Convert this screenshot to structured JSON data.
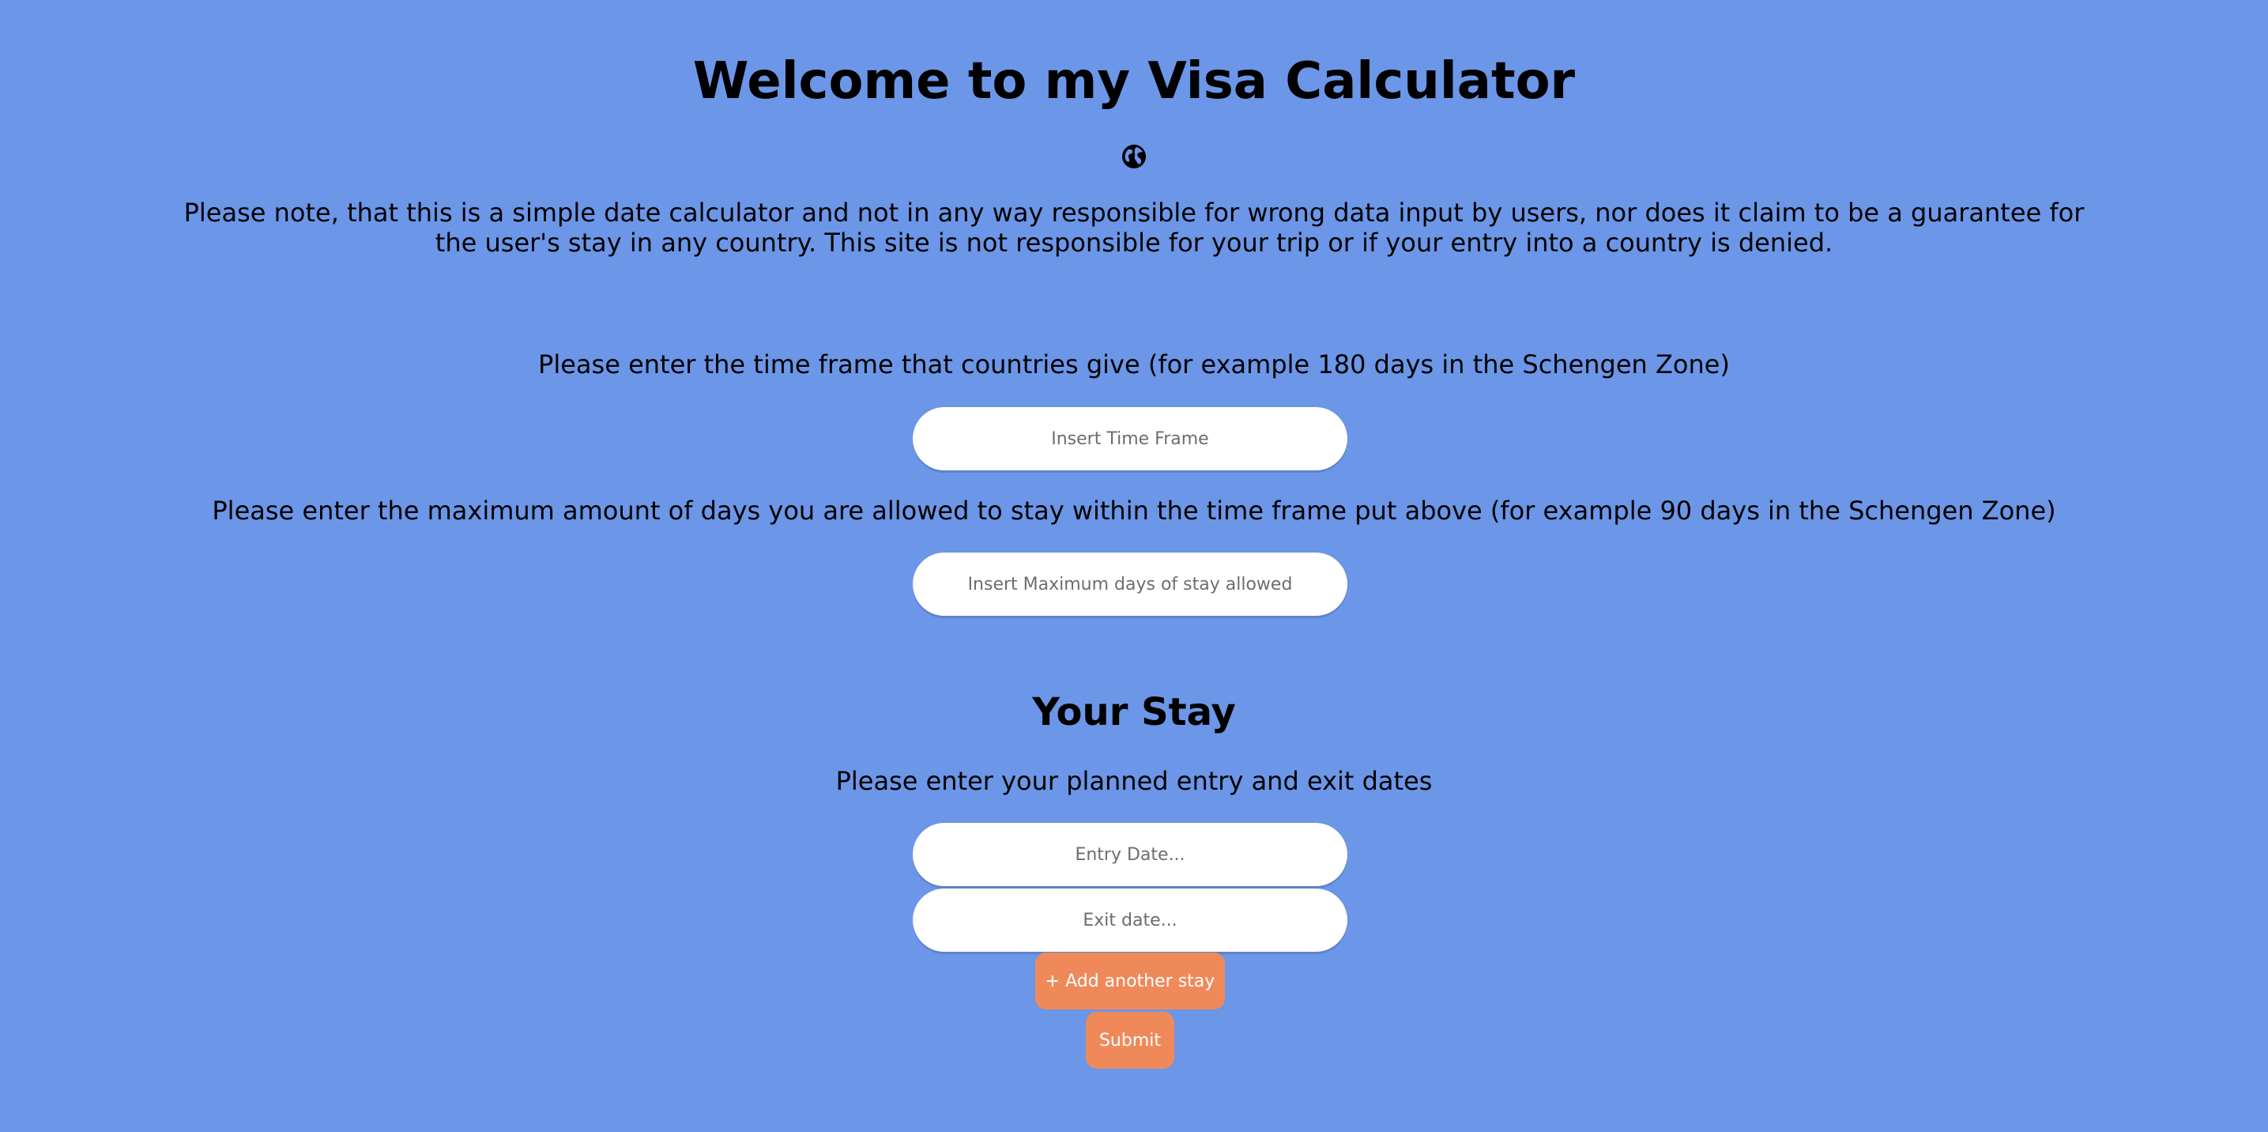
{
  "header": {
    "title": "Welcome to my Visa Calculator",
    "globe_icon": "globe-icon"
  },
  "disclaimer": {
    "line1": "Please note, that this is a simple date calculator and not in any way responsible for wrong data input by users, nor does it claim to be a guarantee for",
    "line2": "the user's stay in any country. This site is not responsible for your trip or if your entry into a country is denied."
  },
  "time_frame": {
    "prompt": "Please enter the time frame that countries give (for example 180 days in the Schengen Zone)",
    "placeholder": "Insert Time Frame",
    "value": ""
  },
  "max_days": {
    "prompt": "Please enter the maximum amount of days you are allowed to stay within the time frame put above (for example 90 days in the Schengen Zone)",
    "placeholder": "Insert Maximum days of stay allowed",
    "value": ""
  },
  "stay": {
    "heading": "Your Stay",
    "prompt": "Please enter your planned entry and exit dates",
    "entry_placeholder": "Entry Date...",
    "exit_placeholder": "Exit date...",
    "add_label": "+ Add another stay",
    "submit_label": "Submit"
  },
  "colors": {
    "background": "#6c96e7",
    "button": "#f0895a",
    "input": "#ffffff"
  }
}
